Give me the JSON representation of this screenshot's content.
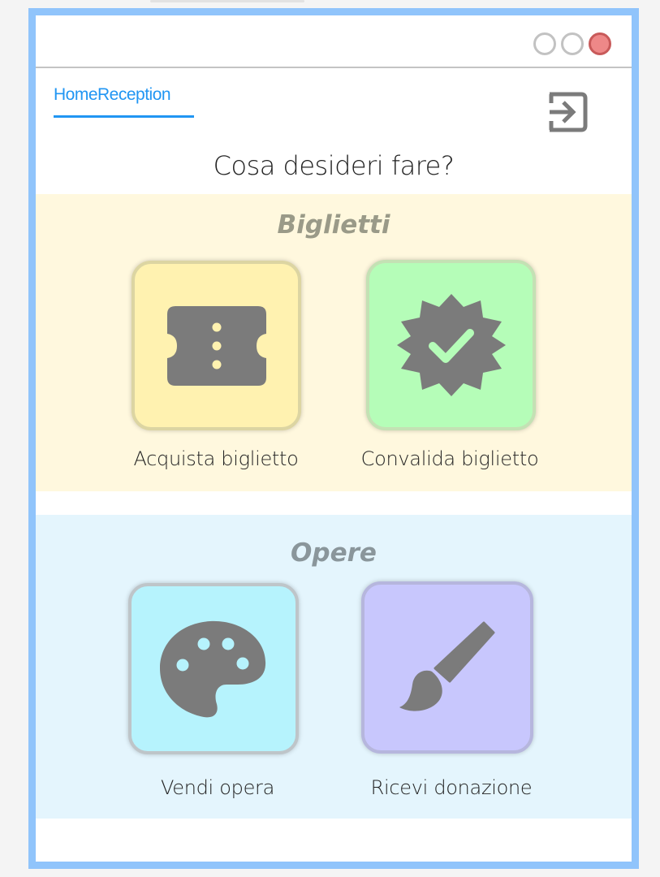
{
  "window": {
    "controls": [
      "minimize",
      "maximize",
      "close"
    ]
  },
  "nav": {
    "tab_label": "HomeReception",
    "logout_icon": "logout-icon"
  },
  "heading": "Cosa desideri fare?",
  "sections": {
    "tickets": {
      "title": "Biglietti",
      "buy": {
        "label": "Acquista biglietto",
        "icon": "ticket-icon"
      },
      "validate": {
        "label": "Convalida biglietto",
        "icon": "verified-badge-icon"
      }
    },
    "works": {
      "title": "Opere",
      "sell": {
        "label": "Vendi opera",
        "icon": "palette-icon"
      },
      "donate": {
        "label": "Ricevi donazione",
        "icon": "brush-icon"
      }
    }
  },
  "colors": {
    "accent": "#2196f3",
    "window_border": "#90c4fb",
    "tickets_bg": "#fff8de",
    "works_bg": "#e4f5fd",
    "buy_card": "#fff2b0",
    "validate_card": "#b5fdb8",
    "sell_card": "#b6f3fd",
    "donate_card": "#c8c7fd",
    "icon_gray": "#7b7b7b"
  }
}
